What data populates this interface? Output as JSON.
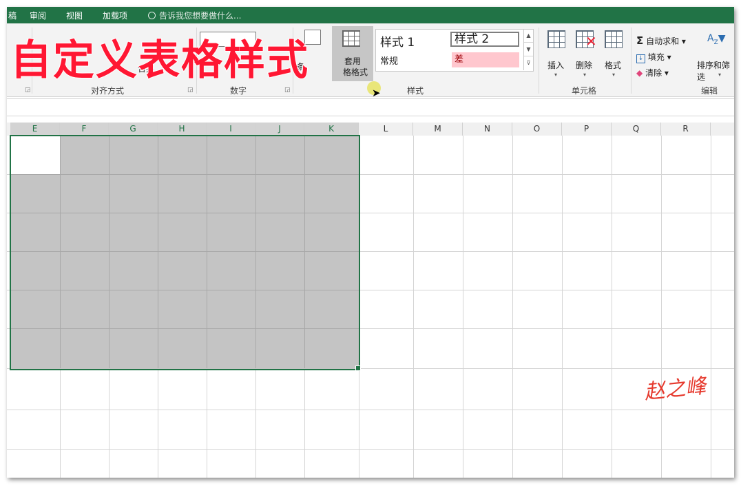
{
  "menu_tabs": [
    "稿",
    "审阅",
    "视图",
    "加载项"
  ],
  "tell_me": "告诉我您想要做什么...",
  "overlay_title": "自定义表格样式",
  "ribbon": {
    "alignment_label": "对齐方式",
    "number_label": "数字",
    "styles_label": "样式",
    "cells_label": "单元格",
    "editing_label": "编辑",
    "merge_partial": "合并",
    "conditional_partial": "条",
    "table_format_line1": "套用",
    "table_format_line2": "格格式",
    "style1": "样式 1",
    "style2": "样式 2",
    "normal": "常规",
    "bad": "差",
    "insert": "插入",
    "delete": "删除",
    "format": "格式",
    "autosum": "自动求和",
    "fill": "填充",
    "clear": "清除",
    "sort_filter": "排序和筛选"
  },
  "columns": [
    "E",
    "F",
    "G",
    "H",
    "I",
    "J",
    "K",
    "L",
    "M",
    "N",
    "O",
    "P",
    "Q",
    "R"
  ],
  "signature": "赵之峰",
  "colors": {
    "excel_green": "#217346",
    "selection_gray": "#c4c4c4",
    "bad_fill": "#ffc7ce",
    "bad_text": "#9c0006"
  }
}
